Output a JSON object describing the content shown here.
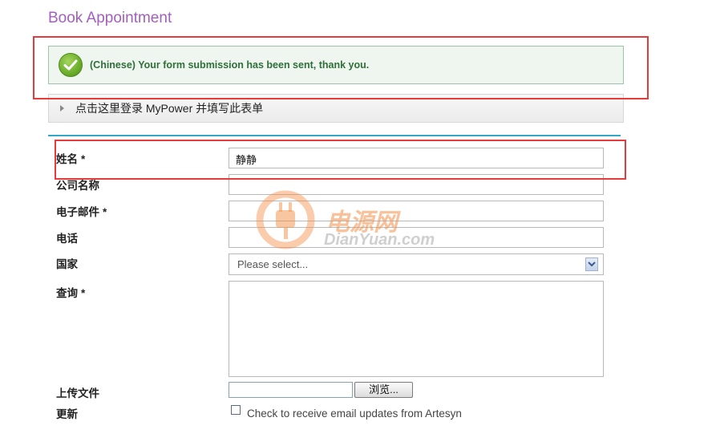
{
  "page": {
    "title": "Book Appointment"
  },
  "success": {
    "message": "(Chinese) Your form submission has been sent, thank you."
  },
  "login_bar": {
    "label": "点击这里登录 MyPower 并填写此表单"
  },
  "form": {
    "name": {
      "label": "姓名",
      "required": "*",
      "value": "静静"
    },
    "company": {
      "label": "公司名称",
      "value": ""
    },
    "email": {
      "label": "电子邮件",
      "required": "*",
      "value": ""
    },
    "phone": {
      "label": "电话",
      "value": ""
    },
    "country": {
      "label": "国家",
      "selected": "Please select..."
    },
    "inquiry": {
      "label": "查询",
      "required": "*",
      "value": ""
    },
    "upload": {
      "label": "上传文件",
      "browse_label": "浏览..."
    },
    "updates": {
      "label": "更新",
      "checkbox_label": "Check to receive email updates from Artesyn"
    }
  },
  "watermark": {
    "cn": "电源网",
    "en": "DianYuan.com"
  },
  "colors": {
    "title": "#a35fc0",
    "success_text": "#2f6f3a",
    "divider": "#35a7c9",
    "highlight_box": "#e53b3b"
  },
  "icons": {
    "success": "check-circle-icon",
    "login_bar": "caret-right-icon",
    "select": "chevron-down-icon",
    "watermark": "plug-logo-icon"
  }
}
